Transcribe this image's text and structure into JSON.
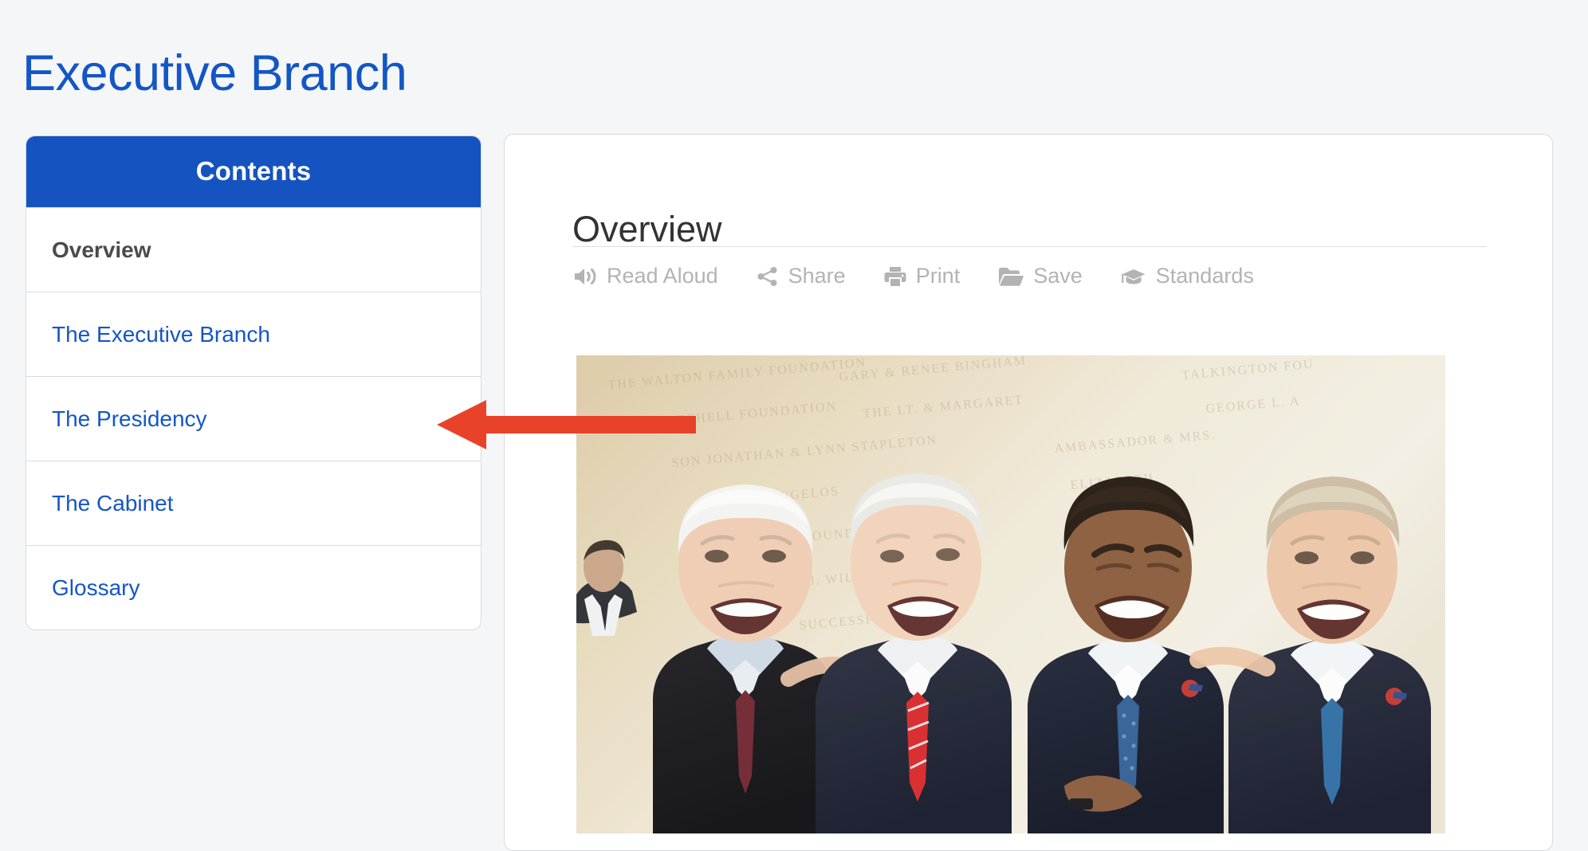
{
  "page": {
    "title": "Executive Branch",
    "title_color": "#1356c5",
    "background_color": "#f5f6f8"
  },
  "sidebar": {
    "header": "Contents",
    "header_bg": "#1554c0",
    "header_text_color": "#ffffff",
    "link_color": "#1556c6",
    "items": [
      {
        "label": "Overview",
        "active": true
      },
      {
        "label": "The Executive Branch",
        "active": false
      },
      {
        "label": "The Presidency",
        "active": false
      },
      {
        "label": "The Cabinet",
        "active": false
      },
      {
        "label": "Glossary",
        "active": false
      }
    ]
  },
  "main": {
    "heading": "Overview",
    "toolbar": [
      {
        "icon": "volume-up-icon",
        "label": "Read Aloud"
      },
      {
        "icon": "share-nodes-icon",
        "label": "Share"
      },
      {
        "icon": "printer-icon",
        "label": "Print"
      },
      {
        "icon": "folder-open-icon",
        "label": "Save"
      },
      {
        "icon": "graduation-cap-icon",
        "label": "Standards"
      }
    ],
    "toolbar_text_color": "#b3b3b3",
    "photo": {
      "alt": "Four former U.S. presidents Jimmy Carter, Bill Clinton, Barack Obama and George W. Bush laughing together in front of an engraved limestone donor wall"
    }
  },
  "annotation": {
    "arrow": {
      "color": "#e8432a",
      "direction": "left",
      "points_to": "The Presidency"
    }
  }
}
